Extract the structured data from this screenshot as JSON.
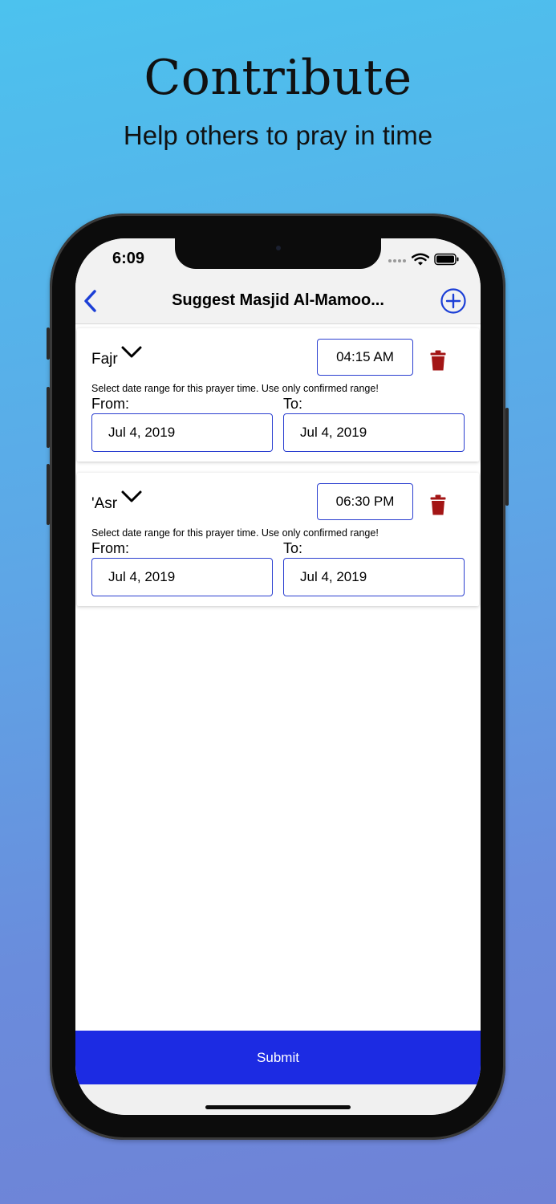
{
  "promo": {
    "title": "Contribute",
    "subtitle": "Help others to pray in time"
  },
  "status_bar": {
    "time": "6:09",
    "icons": [
      "signal-icon",
      "wifi-icon",
      "battery-icon"
    ]
  },
  "nav": {
    "title": "Suggest Masjid Al-Mamoo...",
    "back_icon": "chevron-left-icon",
    "add_icon": "plus-circle-icon"
  },
  "prayers": [
    {
      "name": "Fajr",
      "time": "04:15 AM",
      "hint": "Select date range for this prayer time. Use only confirmed range!",
      "from_label": "From:",
      "to_label": "To:",
      "from_date": "Jul 4, 2019",
      "to_date": "Jul 4, 2019"
    },
    {
      "name": "'Asr",
      "time": "06:30 PM",
      "hint": "Select date range for this prayer time. Use only confirmed range!",
      "from_label": "From:",
      "to_label": "To:",
      "from_date": "Jul 4, 2019",
      "to_date": "Jul 4, 2019"
    }
  ],
  "submit_label": "Submit",
  "colors": {
    "accent": "#1c2be3",
    "field_border": "#2b3fd0",
    "delete": "#a31515",
    "nav_bg": "#f2f2f2"
  }
}
